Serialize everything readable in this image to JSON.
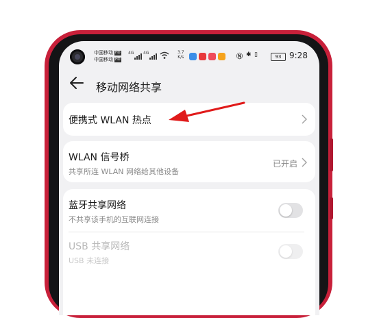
{
  "colors": {
    "phone_frame": "#c8203a",
    "annotation_arrow": "#e01a1a",
    "screen_bg": "#f1f1f3",
    "card_bg": "#ffffff"
  },
  "status_bar": {
    "carrier_1": "中国移动",
    "carrier_2": "中国移动",
    "hd_badge": "HD",
    "network_1": "4G",
    "network_2": "4G",
    "net_speed_value": "3.7",
    "net_speed_unit": "K/s",
    "battery": "93",
    "time": "9:28",
    "icons": [
      "signal-icon",
      "wifi-icon",
      "app-notification-icons",
      "nfc-icon",
      "bluetooth-icon",
      "vibrate-icon",
      "battery-icon"
    ]
  },
  "header": {
    "back_icon": "back-arrow-icon",
    "title": "移动网络共享"
  },
  "settings": {
    "hotspot": {
      "title": "便携式 WLAN 热点",
      "icon": "chevron-right-icon"
    },
    "wlan_bridge": {
      "title": "WLAN 信号桥",
      "subtitle": "共享所连 WLAN 网络给其他设备",
      "status": "已开启",
      "icon": "chevron-right-icon"
    },
    "bluetooth_tethering": {
      "title": "蓝牙共享网络",
      "subtitle": "不共享该手机的互联网连接",
      "enabled": false
    },
    "usb_tethering": {
      "title": "USB 共享网络",
      "subtitle": "USB 未连接",
      "enabled": false,
      "disabled": true
    }
  }
}
